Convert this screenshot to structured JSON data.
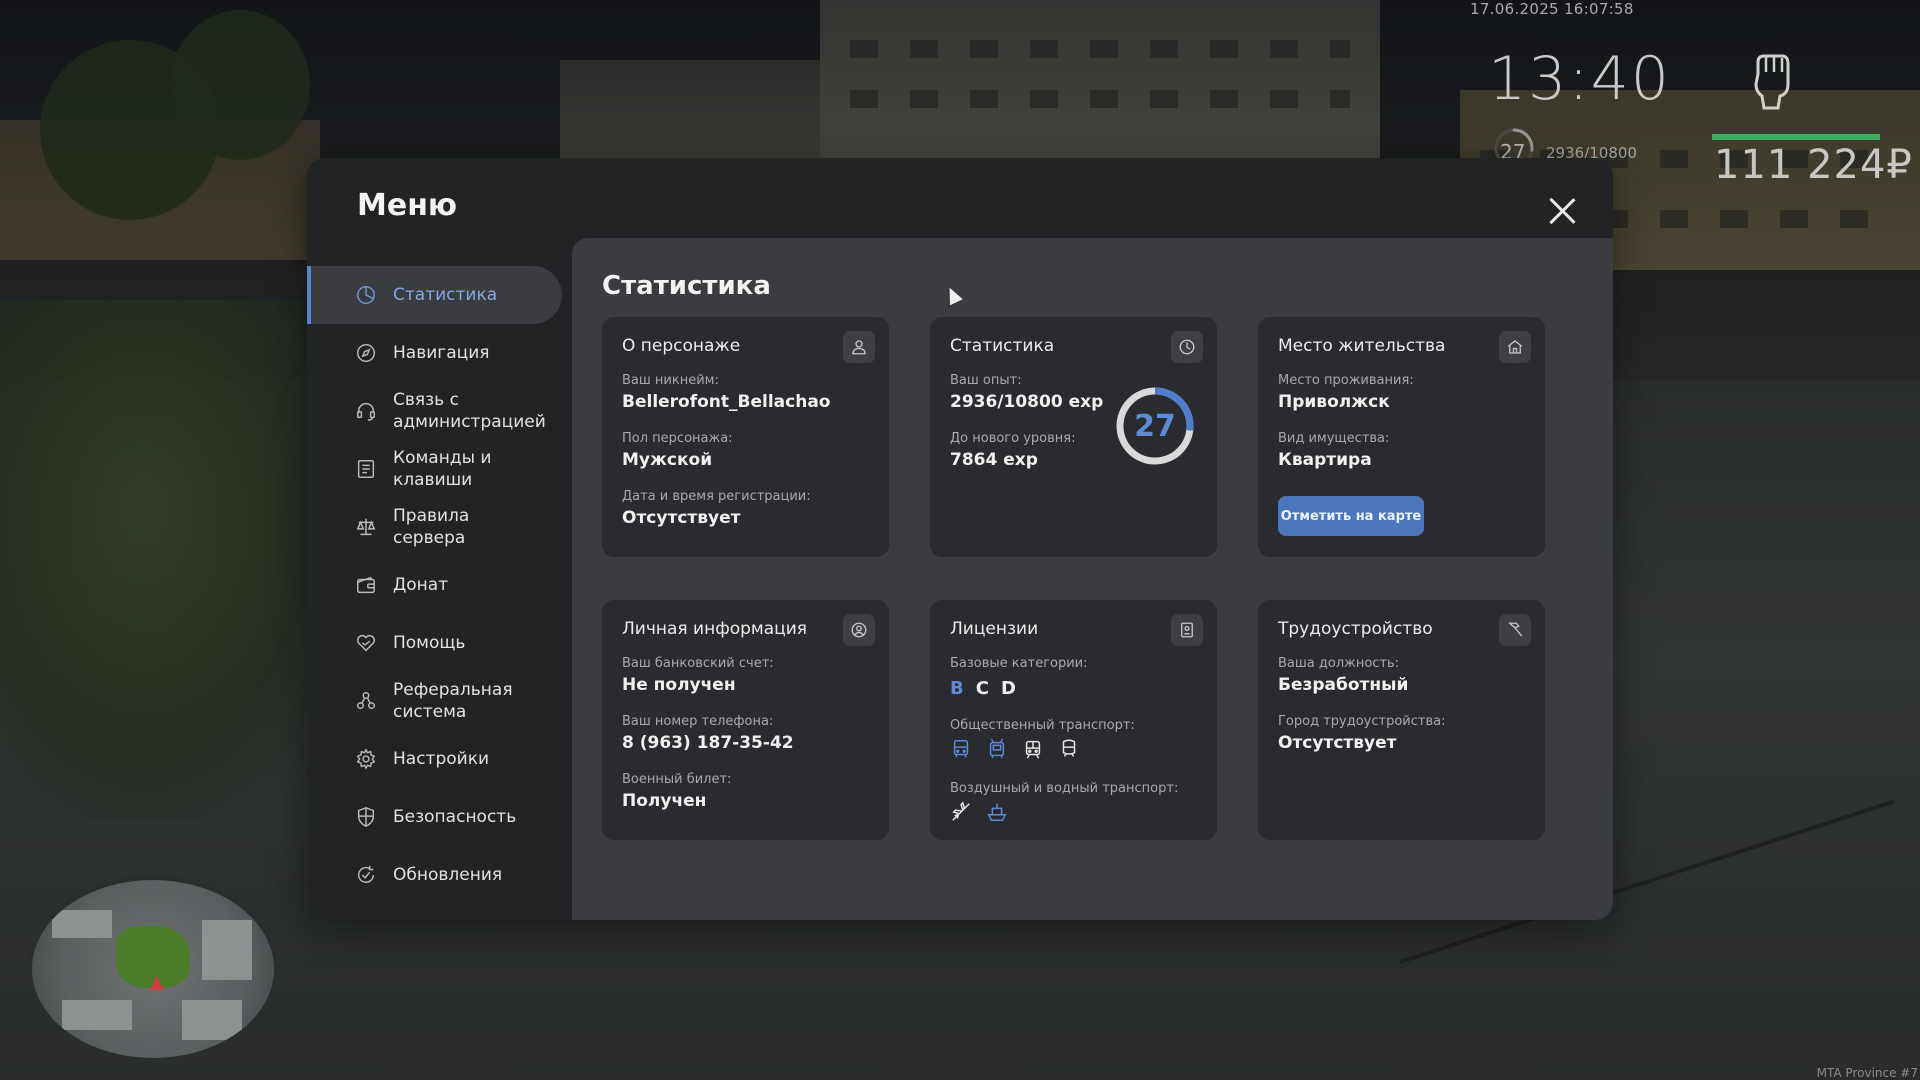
{
  "hud": {
    "datetime": "17.06.2025 16:07:58",
    "clock": "13:40",
    "level": "27",
    "exp": "2936/10800",
    "money": "111 224₽",
    "health_fraction": 1.0,
    "health_color": "#3bb364",
    "level_fraction": 0.27,
    "server": "MTA Province #7"
  },
  "modal": {
    "title": "Меню",
    "close_icon": "close-icon"
  },
  "sidebar": {
    "items": [
      {
        "label": "Статистика",
        "icon": "pie-chart-icon",
        "active": true
      },
      {
        "label": "Навигация",
        "icon": "compass-icon"
      },
      {
        "label": "Связь с администрацией",
        "icon": "headset-icon"
      },
      {
        "label": "Команды и клавиши",
        "icon": "list-icon"
      },
      {
        "label": "Правила сервера",
        "icon": "scales-icon"
      },
      {
        "label": "Донат",
        "icon": "wallet-icon"
      },
      {
        "label": "Помощь",
        "icon": "heart-hand-icon"
      },
      {
        "label": "Реферальная система",
        "icon": "referral-icon"
      },
      {
        "label": "Настройки",
        "icon": "gear-icon"
      },
      {
        "label": "Безопасность",
        "icon": "shield-icon"
      },
      {
        "label": "Обновления",
        "icon": "refresh-check-icon"
      }
    ]
  },
  "content": {
    "title": "Статистика"
  },
  "cards": {
    "character": {
      "title": "О персонаже",
      "icon": "user-icon",
      "nickname_label": "Ваш никнейм:",
      "nickname": "Bellerofont_Bellachao",
      "gender_label": "Пол персонажа:",
      "gender": "Мужской",
      "reg_label": "Дата и время регистрации:",
      "reg": "Отсутствует"
    },
    "stats": {
      "title": "Статистика",
      "icon": "pie-chart-icon",
      "exp_label": "Ваш опыт:",
      "exp": "2936/10800 exp",
      "next_label": "До нового уровня:",
      "next": "7864 exp",
      "level": "27",
      "progress": 0.27
    },
    "residence": {
      "title": "Место жительства",
      "icon": "house-icon",
      "place_label": "Место проживания:",
      "place": "Приволжск",
      "property_label": "Вид имущества:",
      "property": "Квартира",
      "button": "Отметить на карте"
    },
    "personal": {
      "title": "Личная информация",
      "icon": "user-circle-icon",
      "bank_label": "Ваш банковский счет:",
      "bank": "Не получен",
      "phone_label": "Ваш номер телефона:",
      "phone": "8 (963) 187-35-42",
      "military_label": "Военный билет:",
      "military": "Получен"
    },
    "licenses": {
      "title": "Лицензии",
      "icon": "document-icon",
      "base_label": "Базовые категории:",
      "categories": [
        {
          "name": "B",
          "highlight": true
        },
        {
          "name": "C",
          "highlight": false
        },
        {
          "name": "D",
          "highlight": false
        }
      ],
      "public_label": "Общественный транспорт:",
      "air_label": "Воздушный и водный транспорт:"
    },
    "employment": {
      "title": "Трудоустройство",
      "icon": "hammer-icon",
      "position_label": "Ваша должность:",
      "position": "Безработный",
      "city_label": "Город трудоустройства:",
      "city": "Отсутствует"
    }
  },
  "colors": {
    "accent": "#5a84c9",
    "card_bg": "#2a2b2e",
    "content_bg": "#3b3c3f",
    "modal_bg": "#222325"
  }
}
